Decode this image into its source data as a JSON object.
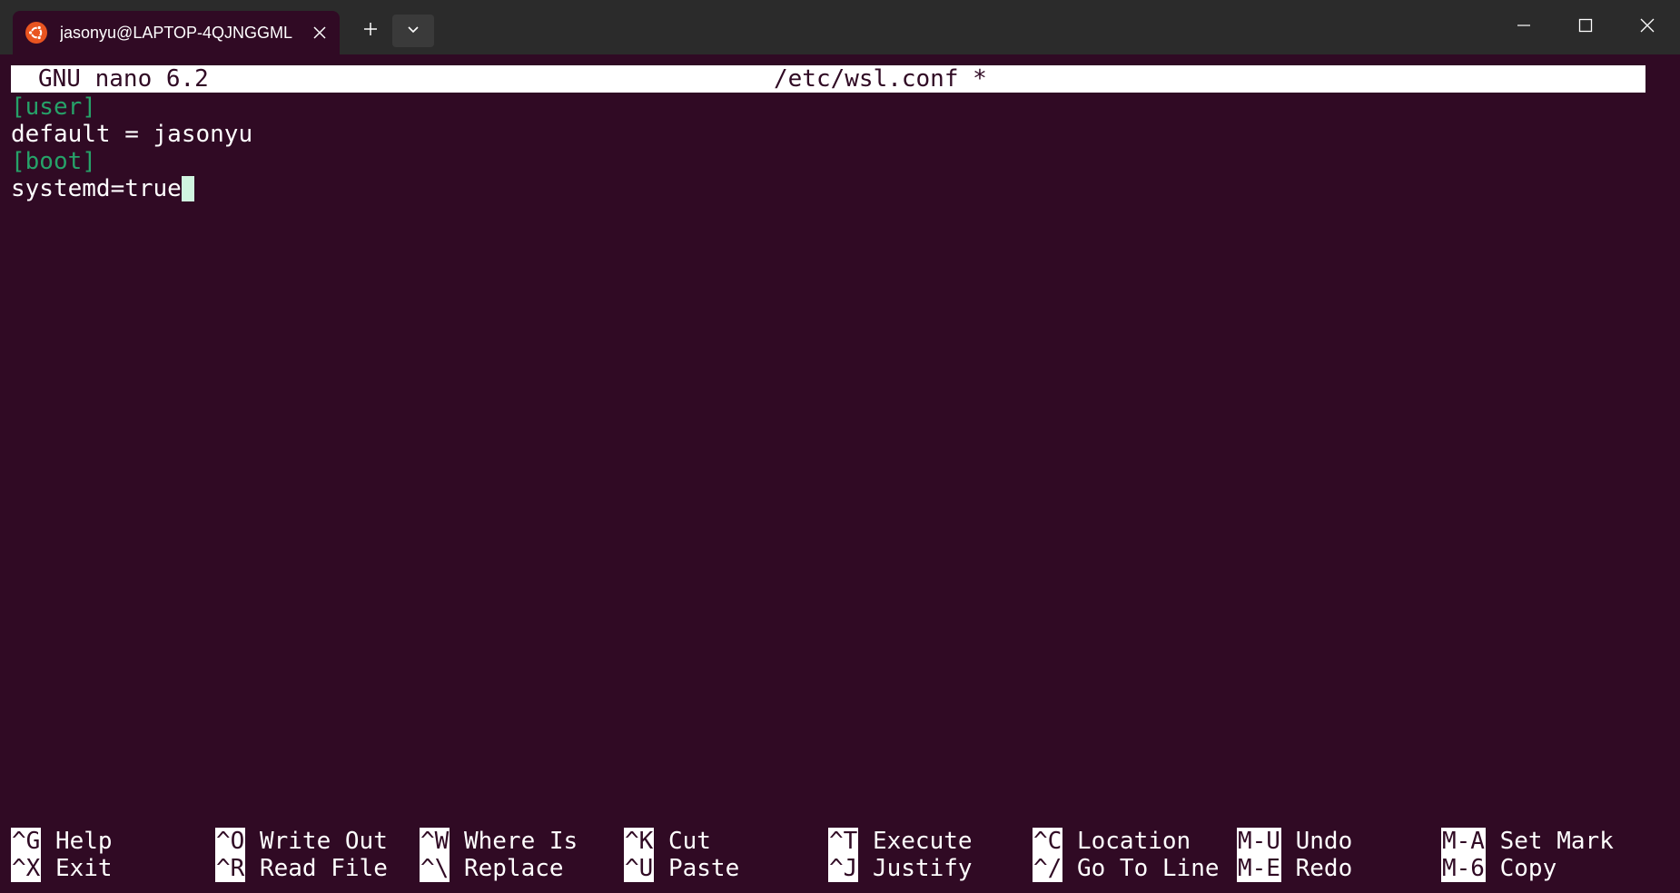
{
  "window": {
    "tab_title": "jasonyu@LAPTOP-4QJNGGML",
    "tab_icon": "ubuntu-icon",
    "controls": [
      "minimize-icon",
      "maximize-icon",
      "close-icon"
    ]
  },
  "nano": {
    "version": "GNU nano 6.2",
    "filename": "/etc/wsl.conf *",
    "lines": [
      {
        "text": "[user]",
        "kind": "section"
      },
      {
        "text": "default = jasonyu",
        "kind": "plain"
      },
      {
        "text": "[boot]",
        "kind": "section"
      },
      {
        "text": "systemd=true",
        "kind": "plain"
      }
    ],
    "shortcuts_row1": [
      {
        "key": "^G",
        "label": "Help"
      },
      {
        "key": "^O",
        "label": "Write Out"
      },
      {
        "key": "^W",
        "label": "Where Is"
      },
      {
        "key": "^K",
        "label": "Cut"
      },
      {
        "key": "^T",
        "label": "Execute"
      },
      {
        "key": "^C",
        "label": "Location"
      },
      {
        "key": "M-U",
        "label": "Undo"
      },
      {
        "key": "M-A",
        "label": "Set Mark"
      }
    ],
    "shortcuts_row2": [
      {
        "key": "^X",
        "label": "Exit"
      },
      {
        "key": "^R",
        "label": "Read File"
      },
      {
        "key": "^\\",
        "label": "Replace"
      },
      {
        "key": "^U",
        "label": "Paste"
      },
      {
        "key": "^J",
        "label": "Justify"
      },
      {
        "key": "^/",
        "label": "Go To Line"
      },
      {
        "key": "M-E",
        "label": "Redo"
      },
      {
        "key": "M-6",
        "label": "Copy"
      }
    ]
  },
  "colors": {
    "terminal_bg": "#300a24",
    "titlebar_bg": "#2b2b2b",
    "section_green": "#26a269",
    "cursor": "#d0f5e0",
    "ubuntu_orange": "#e95420"
  }
}
